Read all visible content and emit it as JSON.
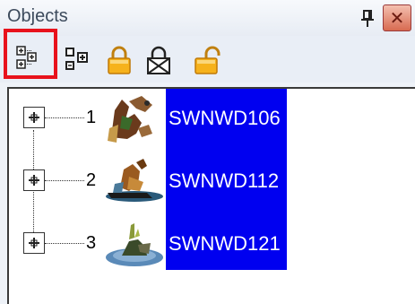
{
  "panel": {
    "title": "Objects"
  },
  "toolbar": {
    "buttons": [
      {
        "name": "expand-all",
        "icon": "expand-tree-icon",
        "selected": true
      },
      {
        "name": "collapse-all",
        "icon": "collapse-tree-icon",
        "selected": false
      },
      {
        "name": "lock",
        "icon": "lock-icon",
        "selected": false
      },
      {
        "name": "lock-toggle",
        "icon": "lock-crossed-icon",
        "selected": false
      },
      {
        "name": "unlock",
        "icon": "unlock-icon",
        "selected": false
      }
    ]
  },
  "tree": {
    "items": [
      {
        "number": "1",
        "label": "SWNWD106",
        "thumbnail": "bird-thumbnail-icon"
      },
      {
        "number": "2",
        "label": "SWNWD112",
        "thumbnail": "bird-on-water-thumbnail-icon"
      },
      {
        "number": "3",
        "label": "SWNWD121",
        "thumbnail": "plant-island-thumbnail-icon"
      }
    ]
  },
  "colors": {
    "selection": "#0000f0",
    "highlight_border": "#e8121c"
  }
}
